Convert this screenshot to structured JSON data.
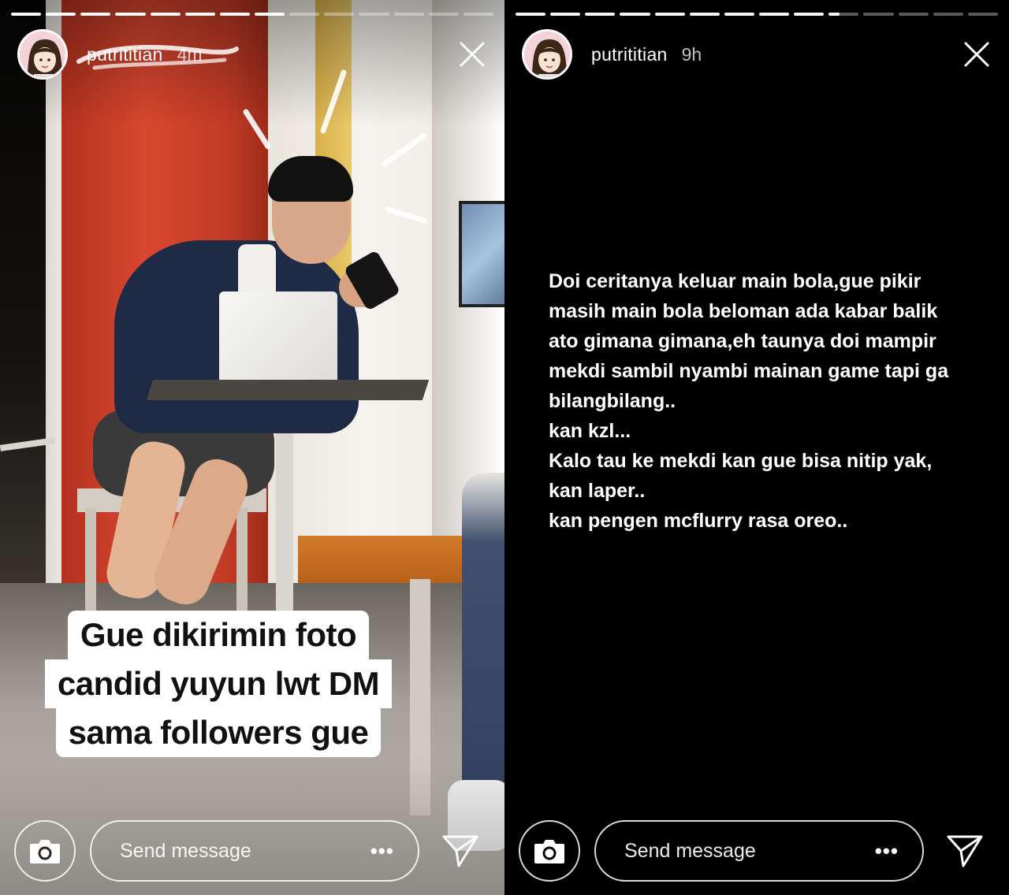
{
  "stories": [
    {
      "progress_fill": [
        1,
        1,
        1,
        1,
        1,
        1,
        1,
        1,
        0,
        0,
        0,
        0,
        0,
        0
      ],
      "username": "putrititian",
      "time": "4m",
      "caption_lines": [
        "Gue dikirimin foto",
        "candid yuyun lwt DM",
        "sama followers gue"
      ],
      "message_placeholder": "Send message",
      "more_label": "•••"
    },
    {
      "progress_fill": [
        1,
        1,
        1,
        1,
        1,
        1,
        1,
        1,
        1,
        0.35,
        0,
        0,
        0,
        0
      ],
      "username": "putrititian",
      "time": "9h",
      "text_lines": [
        "Doi ceritanya keluar main bola,gue pikir",
        "masih main bola beloman ada kabar balik",
        "ato gimana gimana,eh taunya doi mampir",
        "mekdi sambil nyambi mainan game tapi ga",
        "bilangbilang..",
        "kan kzl...",
        "Kalo tau ke mekdi kan gue bisa nitip yak,",
        "kan laper..",
        "kan pengen mcflurry rasa oreo.."
      ],
      "message_placeholder": "Send message",
      "more_label": "•••"
    }
  ],
  "icons": {
    "close": "close-icon",
    "camera": "camera-icon",
    "send": "send-icon",
    "more": "more-dots-icon"
  }
}
